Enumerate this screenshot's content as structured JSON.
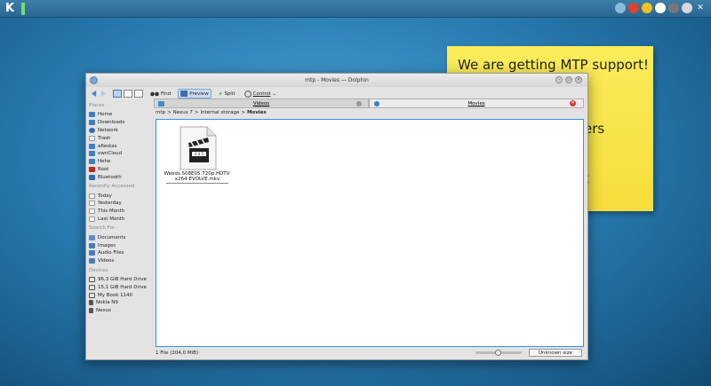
{
  "panel": {
    "kicker_label": "K",
    "tray_icons": [
      "network-icon",
      "notification-icon",
      "clock-icon",
      "search-icon",
      "device-icon",
      "lock-icon",
      "close-icon"
    ]
  },
  "note": {
    "line1": "We are getting MTP support!",
    "frag1": "ers",
    "frag2": "t"
  },
  "window": {
    "title": "mtp - Movies — Dolphin",
    "toolbar": {
      "find": "Find",
      "preview": "Preview",
      "split": "Split",
      "control": "Control"
    },
    "tabs": [
      {
        "label": "Videos"
      },
      {
        "label": "Movies"
      }
    ],
    "breadcrumb": [
      "mtp",
      "Nexus 7",
      "Internal storage",
      "Movies"
    ],
    "sidebar": {
      "places_header": "Places",
      "places": [
        "Home",
        "Downloads",
        "Network",
        "Trash",
        "afiestas",
        "ownCloud",
        "Hehe",
        "Root",
        "Bluetooth"
      ],
      "recent_header": "Recently Accessed",
      "recent": [
        "Today",
        "Yesterday",
        "This Month",
        "Last Month"
      ],
      "search_header": "Search For",
      "search": [
        "Documents",
        "Images",
        "Audio Files",
        "Videos"
      ],
      "devices_header": "Devices",
      "devices": [
        "96,3 GiB Hard Drive",
        "15,1 GiB Hard Drive",
        "My Book 1140",
        "Nokia N9",
        "Nexus"
      ]
    },
    "file": {
      "name_line1": "Weeds.S08E05.720p.HDTV.",
      "name_line2": "x264-EVOLVE.mkv"
    },
    "status": {
      "text": "1 File (204,0 MiB)",
      "size_box": "Unknown size"
    }
  }
}
